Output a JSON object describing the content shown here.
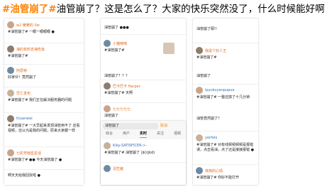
{
  "headline": {
    "tag": "#油管崩了#",
    "text": "油管崩了？这是怎么了？大家的快乐突然没了，什么时候能好啊"
  },
  "col1": {
    "posts": [
      {
        "name": "w2 暖暖的 0w",
        "text": "#油管崩了# 一眼一眼眼眼 ●"
      },
      {
        "name": "海豹有料去海吃饭",
        "text": "#油管崩了#"
      },
      {
        "name": "阿思特",
        "text": "好家伙！竟然崩了"
      },
      {
        "name": "早亡发布",
        "text": "#油管崩了# 我们正在解决服务器的问题"
      },
      {
        "name": "tiluanwei",
        "text": "#油管崩了# 一大早起来发现油管用不了 还看视频，还以为是我的问题，原来大家都一样"
      },
      {
        "name": "七彩芳雨星星话",
        "text": "#油管崩了# ●● 今天油管崩了 ●"
      },
      {
        "name": "",
        "text": "啊天天给我回找啦 ●"
      }
    ]
  },
  "col2": {
    "posts": [
      {
        "name": "",
        "text": "油管崩了 ●●●"
      },
      {
        "name": "小猫咪咪",
        "text": "#油管崩了#"
      },
      {
        "name": "",
        "text": "油管崩了？？？"
      },
      {
        "name": "巴卡巴卡 Harper",
        "text": "#油管崩了# 天啊"
      },
      {
        "name": "",
        "text": "油管崩了"
      },
      {
        "name": "七七七七七",
        "text": "#油管崩了# 崩了"
      }
    ],
    "search": {
      "query": "油管崩了",
      "cancel": "取消",
      "tabs": [
        "综合",
        "用户",
        "实时",
        "关注",
        "视频"
      ]
    },
    "posts2": [
      {
        "name": "Kiky-SATISFICER->-",
        "text": "#油管崩了# 油管崩了 (jk)(jkd)"
      },
      {
        "name": "羽芝酱",
        "text": "怎么了，是崩了"
      }
    ]
  },
  "col3": {
    "posts": [
      {
        "name": "",
        "text": "油管崩了耶!!"
      },
      {
        "name": "我是个好人王",
        "text": "#油管崩了#"
      },
      {
        "name": "",
        "text": "油管崩了"
      },
      {
        "name": "lpyukuyanpupue",
        "text": "#油管崩了# 一整还搞了十几分钟"
      },
      {
        "name": "",
        "text": "油管竟然崩了？"
      },
      {
        "name": "yerfelo",
        "text": "#油管崩了# 对有线频频频频是报错误，点击看油，点了还是接接报错 ●"
      },
      {
        "name": "抹抹的心情",
        "text": "#油管崩了# 你好不能打开"
      }
    ]
  },
  "colors": {
    "accent": "#ff8200",
    "link": "#356fb0"
  }
}
